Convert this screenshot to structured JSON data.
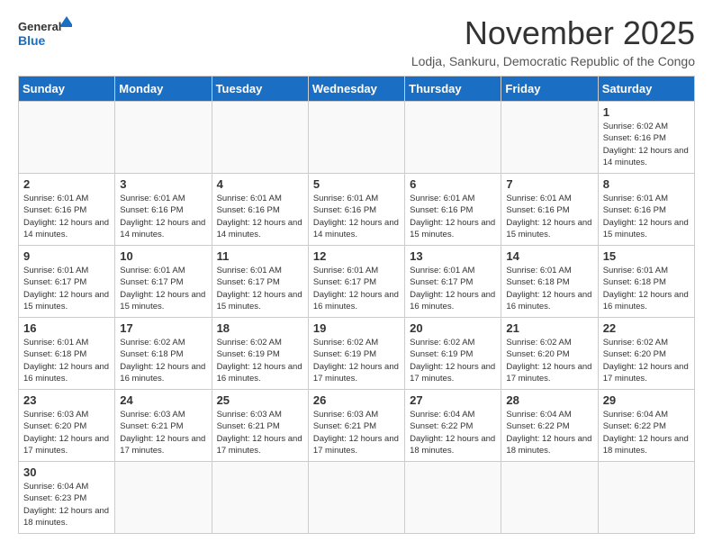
{
  "logo": {
    "line1": "General",
    "line2": "Blue"
  },
  "title": "November 2025",
  "subtitle": "Lodja, Sankuru, Democratic Republic of the Congo",
  "days_of_week": [
    "Sunday",
    "Monday",
    "Tuesday",
    "Wednesday",
    "Thursday",
    "Friday",
    "Saturday"
  ],
  "weeks": [
    [
      {
        "day": "",
        "info": ""
      },
      {
        "day": "",
        "info": ""
      },
      {
        "day": "",
        "info": ""
      },
      {
        "day": "",
        "info": ""
      },
      {
        "day": "",
        "info": ""
      },
      {
        "day": "",
        "info": ""
      },
      {
        "day": "1",
        "info": "Sunrise: 6:02 AM\nSunset: 6:16 PM\nDaylight: 12 hours and 14 minutes."
      }
    ],
    [
      {
        "day": "2",
        "info": "Sunrise: 6:01 AM\nSunset: 6:16 PM\nDaylight: 12 hours and 14 minutes."
      },
      {
        "day": "3",
        "info": "Sunrise: 6:01 AM\nSunset: 6:16 PM\nDaylight: 12 hours and 14 minutes."
      },
      {
        "day": "4",
        "info": "Sunrise: 6:01 AM\nSunset: 6:16 PM\nDaylight: 12 hours and 14 minutes."
      },
      {
        "day": "5",
        "info": "Sunrise: 6:01 AM\nSunset: 6:16 PM\nDaylight: 12 hours and 14 minutes."
      },
      {
        "day": "6",
        "info": "Sunrise: 6:01 AM\nSunset: 6:16 PM\nDaylight: 12 hours and 15 minutes."
      },
      {
        "day": "7",
        "info": "Sunrise: 6:01 AM\nSunset: 6:16 PM\nDaylight: 12 hours and 15 minutes."
      },
      {
        "day": "8",
        "info": "Sunrise: 6:01 AM\nSunset: 6:16 PM\nDaylight: 12 hours and 15 minutes."
      }
    ],
    [
      {
        "day": "9",
        "info": "Sunrise: 6:01 AM\nSunset: 6:17 PM\nDaylight: 12 hours and 15 minutes."
      },
      {
        "day": "10",
        "info": "Sunrise: 6:01 AM\nSunset: 6:17 PM\nDaylight: 12 hours and 15 minutes."
      },
      {
        "day": "11",
        "info": "Sunrise: 6:01 AM\nSunset: 6:17 PM\nDaylight: 12 hours and 15 minutes."
      },
      {
        "day": "12",
        "info": "Sunrise: 6:01 AM\nSunset: 6:17 PM\nDaylight: 12 hours and 16 minutes."
      },
      {
        "day": "13",
        "info": "Sunrise: 6:01 AM\nSunset: 6:17 PM\nDaylight: 12 hours and 16 minutes."
      },
      {
        "day": "14",
        "info": "Sunrise: 6:01 AM\nSunset: 6:18 PM\nDaylight: 12 hours and 16 minutes."
      },
      {
        "day": "15",
        "info": "Sunrise: 6:01 AM\nSunset: 6:18 PM\nDaylight: 12 hours and 16 minutes."
      }
    ],
    [
      {
        "day": "16",
        "info": "Sunrise: 6:01 AM\nSunset: 6:18 PM\nDaylight: 12 hours and 16 minutes."
      },
      {
        "day": "17",
        "info": "Sunrise: 6:02 AM\nSunset: 6:18 PM\nDaylight: 12 hours and 16 minutes."
      },
      {
        "day": "18",
        "info": "Sunrise: 6:02 AM\nSunset: 6:19 PM\nDaylight: 12 hours and 16 minutes."
      },
      {
        "day": "19",
        "info": "Sunrise: 6:02 AM\nSunset: 6:19 PM\nDaylight: 12 hours and 17 minutes."
      },
      {
        "day": "20",
        "info": "Sunrise: 6:02 AM\nSunset: 6:19 PM\nDaylight: 12 hours and 17 minutes."
      },
      {
        "day": "21",
        "info": "Sunrise: 6:02 AM\nSunset: 6:20 PM\nDaylight: 12 hours and 17 minutes."
      },
      {
        "day": "22",
        "info": "Sunrise: 6:02 AM\nSunset: 6:20 PM\nDaylight: 12 hours and 17 minutes."
      }
    ],
    [
      {
        "day": "23",
        "info": "Sunrise: 6:03 AM\nSunset: 6:20 PM\nDaylight: 12 hours and 17 minutes."
      },
      {
        "day": "24",
        "info": "Sunrise: 6:03 AM\nSunset: 6:21 PM\nDaylight: 12 hours and 17 minutes."
      },
      {
        "day": "25",
        "info": "Sunrise: 6:03 AM\nSunset: 6:21 PM\nDaylight: 12 hours and 17 minutes."
      },
      {
        "day": "26",
        "info": "Sunrise: 6:03 AM\nSunset: 6:21 PM\nDaylight: 12 hours and 17 minutes."
      },
      {
        "day": "27",
        "info": "Sunrise: 6:04 AM\nSunset: 6:22 PM\nDaylight: 12 hours and 18 minutes."
      },
      {
        "day": "28",
        "info": "Sunrise: 6:04 AM\nSunset: 6:22 PM\nDaylight: 12 hours and 18 minutes."
      },
      {
        "day": "29",
        "info": "Sunrise: 6:04 AM\nSunset: 6:22 PM\nDaylight: 12 hours and 18 minutes."
      }
    ],
    [
      {
        "day": "30",
        "info": "Sunrise: 6:04 AM\nSunset: 6:23 PM\nDaylight: 12 hours and 18 minutes."
      },
      {
        "day": "",
        "info": ""
      },
      {
        "day": "",
        "info": ""
      },
      {
        "day": "",
        "info": ""
      },
      {
        "day": "",
        "info": ""
      },
      {
        "day": "",
        "info": ""
      },
      {
        "day": "",
        "info": ""
      }
    ]
  ]
}
